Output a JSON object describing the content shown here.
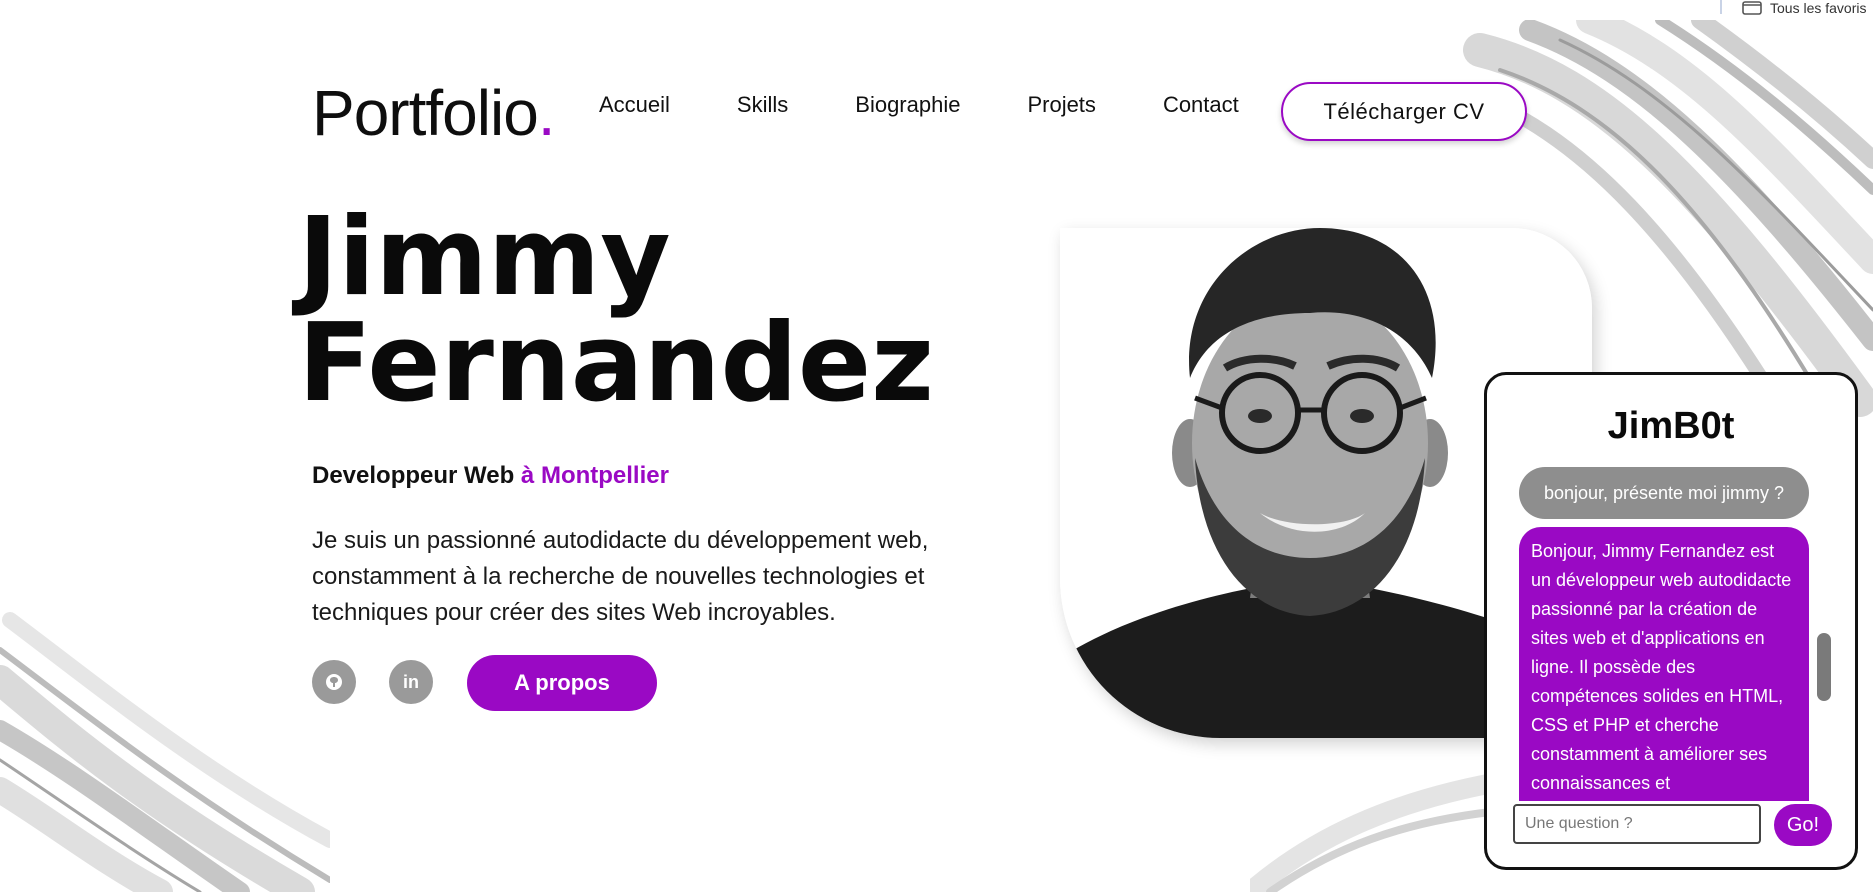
{
  "bookmarks": {
    "folder_label": "Tous les favoris"
  },
  "header": {
    "logo_text": "Portfolio",
    "logo_dot": ".",
    "nav": [
      "Accueil",
      "Skills",
      "Biographie",
      "Projets",
      "Contact"
    ],
    "cv_button": "Télécharger CV"
  },
  "hero": {
    "first_name": "Jimmy",
    "last_name": "Fernandez",
    "role": "Developpeur Web",
    "city": " à Montpellier",
    "bio": "Je suis un passionné autodidacte du développement web, constamment à la recherche de nouvelles technologies et techniques pour créer des sites Web incroyables.",
    "github_icon": "github-icon",
    "linkedin_icon": "linkedin-icon",
    "linkedin_glyph": "in",
    "about_button": "A propos"
  },
  "chatbot": {
    "title": "JimB0t",
    "user_message": "bonjour, présente moi jimmy ?",
    "bot_message": "Bonjour, Jimmy Fernandez est un développeur web autodidacte passionné par la création de sites web et d'applications en ligne. Il possède des compétences solides en HTML, CSS et PHP et cherche constamment à améliorer ses connaissances et",
    "input_placeholder": "Une question ?",
    "send_button": "Go!"
  },
  "colors": {
    "accent": "#9a09c4",
    "grey_button": "#9a9a9a",
    "text": "#111111"
  }
}
